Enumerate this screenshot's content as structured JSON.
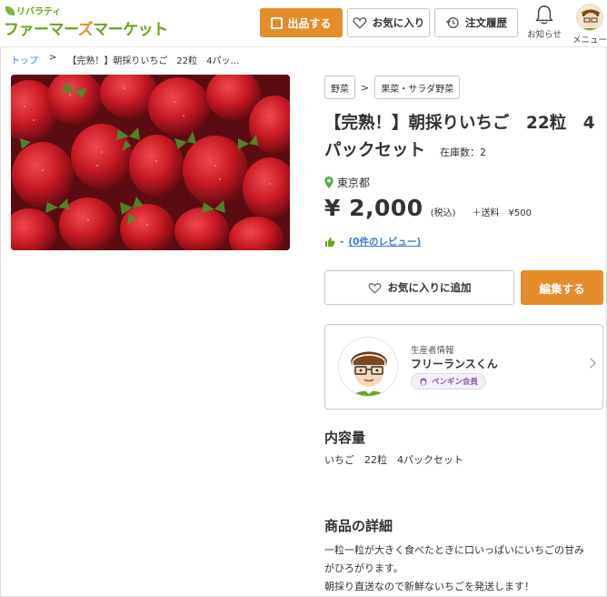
{
  "header": {
    "logo_small": "リバラティ",
    "logo_main_1": "ファーマー",
    "logo_main_2": "ズ",
    "logo_main_3": "マーケット",
    "sell_button": "出品する",
    "favorites_button": "お気に入り",
    "orders_button": "注文履歴",
    "notifications_label": "お知らせ",
    "menu_label": "メニュー"
  },
  "breadcrumb": {
    "home": "トップ",
    "separator": ">",
    "current": "【完熟！】朝採りいちご　22粒　4パッ…"
  },
  "product": {
    "image_icon": "strawberries-photo",
    "categories": [
      "野菜",
      "果菜・サラダ野菜"
    ],
    "category_separator": ">",
    "title": "【完熟！】朝採りいちご　22粒　4パックセット",
    "stock": "在庫数：2",
    "location": "東京都",
    "price": "¥ 2,000",
    "tax": "(税込)",
    "shipping": "＋送料　¥500",
    "rating": "-",
    "review_link": "(0件のレビュー)",
    "add_favorite_button": "お気に入りに追加",
    "edit_button": "編集する"
  },
  "seller": {
    "section_label": "生産者情報",
    "name": "フリーランスくん",
    "badge": "ペンギン会員"
  },
  "contents": {
    "heading": "内容量",
    "text": "いちご　22粒　4パックセット"
  },
  "details": {
    "heading": "商品の詳細",
    "line1": "一粒一粒が大きく食べたときに口いっぱいにいちごの甘み",
    "line2": "がひろがります。",
    "line3": "朝採り直送なので新鮮ないちごを発送します！"
  },
  "colors": {
    "accent_orange": "#e58d2b",
    "brand_green": "#6aa51e",
    "link_blue": "#3a7bd5",
    "badge_purple": "#8a5fb8"
  }
}
